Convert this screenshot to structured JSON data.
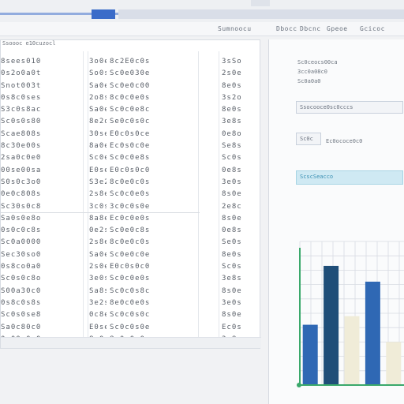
{
  "toolbar": {
    "items": [
      "Sumnoocu",
      "Dbocc",
      "Dbcnc",
      "Gpeoe",
      "Gcicoc"
    ]
  },
  "sheet": {
    "header": "Ssoooc e10cuzocl",
    "columns": [
      {
        "rows": [
          "8sees010",
          "0s2o0a0t",
          "Snot003t",
          "0s8c0ses",
          "S3c0s8ac",
          "Sc0s0s80",
          "Scae808s",
          "8c30e00s",
          "2sa0c0e0",
          "00se00sa",
          "S0s0c3o0",
          "0e0c808s",
          "Sc30s0c8",
          "Sa0s0e8o",
          "0s0c0c8s",
          "Sc0a0000",
          "Sec30so0",
          "0s8co0a0",
          "Sc0s0c8o",
          "S00a30c0",
          "0s8c0s8s",
          "Sc0s0se8",
          "Sa0c80c0",
          "0s00s0c0"
        ]
      },
      {
        "rows": [
          "3o0e",
          "So0s",
          "Sa0e",
          "2o8s",
          "Sa0e",
          "8e2o",
          "30se",
          "8a0e",
          "Sc0e",
          "E0se",
          "S3e2",
          "2s8e",
          "3c0s",
          "8a8e",
          "0e2s",
          "2s8e",
          "Sa0e",
          "2s0e",
          "3e0s",
          "Sa8s",
          "3e2s",
          "0c8e",
          "E0se",
          "8c0s"
        ]
      },
      {
        "rows": [
          "8c2E0c0s",
          "Sc0e030e",
          "Sc0e0c00",
          "8c0c0e0s",
          "Sc0c0e8c",
          "Se0c0s0c",
          "E0c0s0ce",
          "Ec0s0c0e",
          "Sc0c0e8s",
          "E0c0s0c0",
          "8c0e0c0s",
          "Sc0c0e0s",
          "3c0c0s0e",
          "Ec0c0e0s",
          "Sc0e0c8s",
          "8c0e0c0s",
          "Sc0e0c0e",
          "E0c0s0c0",
          "Sc0c0e0s",
          "Sc0c0s8c",
          "8e0c0e0s",
          "Sc0c0s0c",
          "Sc0c0s0e",
          "8c0c0s0e"
        ]
      },
      {
        "rows": [
          "3sSo",
          "2s0e",
          "8e0s",
          "3s2o",
          "8e0s",
          "3e8s",
          "0e8o",
          "Se8s",
          "Sc0s",
          "0e8s",
          "3e0s",
          "8s0e",
          "2e8c",
          "8s0e",
          "0e8s",
          "Se0s",
          "8e0s",
          "Sc0s",
          "3e8s",
          "8s0e",
          "3e0s",
          "8s0e",
          "Ec0s",
          "3e8s"
        ]
      }
    ]
  },
  "panel": {
    "line1": "Sc0ceocs00ca",
    "line2": "3cc0a08c0",
    "line3": "Sc0a0a0",
    "box1": "Ssocooce0sc0cccs",
    "box2_a": "Sc0c",
    "box2_b": "Ec0ococe0c0",
    "box3": "ScscSeacco"
  },
  "colors": {
    "accent": "#3b6cc9",
    "bar_dark": "#1f4e78",
    "bar_blue": "#2f68b4",
    "bar_pale": "#f0ecd8",
    "axis_green": "#3aa86b"
  },
  "chart_data": {
    "type": "bar",
    "categories": [
      "",
      "",
      "",
      "",
      ""
    ],
    "series": [
      {
        "values": [
          42,
          83,
          48,
          72,
          30
        ]
      }
    ],
    "ylim": [
      0,
      100
    ],
    "grid": true
  }
}
